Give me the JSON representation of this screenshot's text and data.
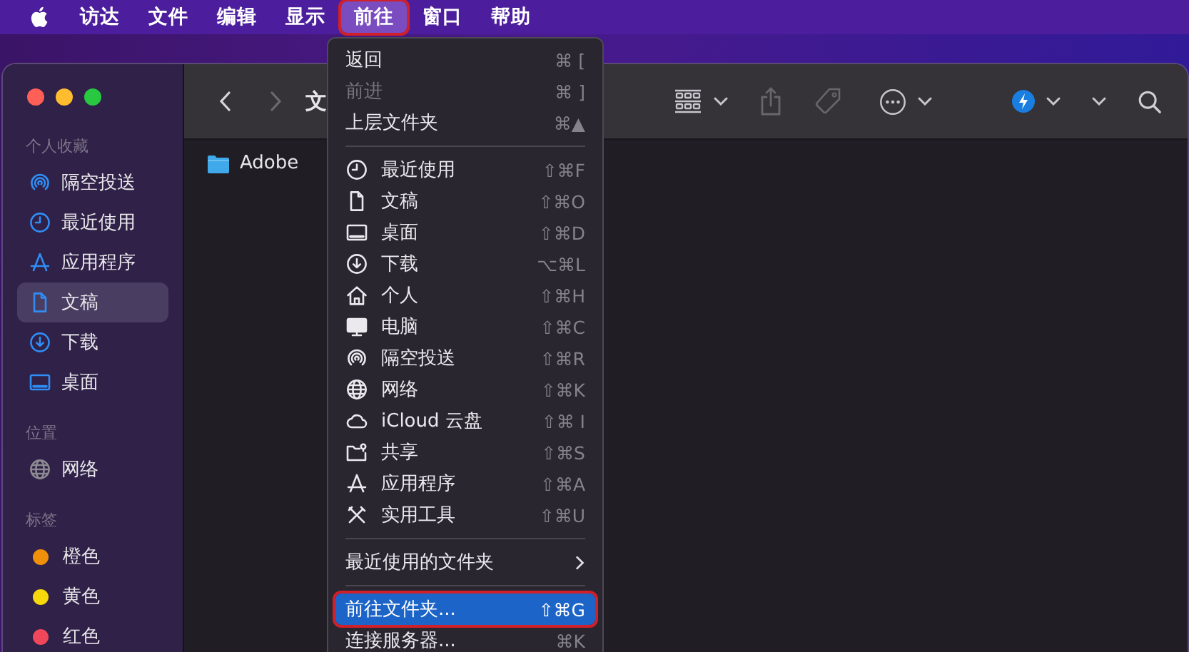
{
  "menubar": {
    "items": [
      {
        "label": "访达",
        "selected": false,
        "annotated": false
      },
      {
        "label": "文件",
        "selected": false,
        "annotated": false
      },
      {
        "label": "编辑",
        "selected": false,
        "annotated": false
      },
      {
        "label": "显示",
        "selected": false,
        "annotated": false
      },
      {
        "label": "前往",
        "selected": true,
        "annotated": true
      },
      {
        "label": "窗口",
        "selected": false,
        "annotated": false
      },
      {
        "label": "帮助",
        "selected": false,
        "annotated": false
      }
    ]
  },
  "window": {
    "title": "文"
  },
  "sidebar": {
    "sections": [
      {
        "heading": "个人收藏",
        "items": [
          {
            "kind": "airdrop",
            "label": "隔空投送",
            "selected": false
          },
          {
            "kind": "clock",
            "label": "最近使用",
            "selected": false
          },
          {
            "kind": "apps",
            "label": "应用程序",
            "selected": false
          },
          {
            "kind": "doc",
            "label": "文稿",
            "selected": true
          },
          {
            "kind": "download",
            "label": "下载",
            "selected": false
          },
          {
            "kind": "desktop",
            "label": "桌面",
            "selected": false
          }
        ]
      },
      {
        "heading": "位置",
        "items": [
          {
            "kind": "globe",
            "label": "网络",
            "selected": false
          }
        ]
      },
      {
        "heading": "标签",
        "items": [
          {
            "kind": "tag",
            "label": "橙色",
            "selected": false,
            "color": "#f0900a"
          },
          {
            "kind": "tag",
            "label": "黄色",
            "selected": false,
            "color": "#f5d90a"
          },
          {
            "kind": "tag",
            "label": "红色",
            "selected": false,
            "color": "#f0485a"
          }
        ]
      }
    ]
  },
  "files": [
    {
      "name": "Adobe"
    }
  ],
  "menu": {
    "items": [
      {
        "kind": "item",
        "label": "返回",
        "shortcut": "⌘ [",
        "disabled": false,
        "selected": false,
        "annotated": false
      },
      {
        "kind": "item",
        "label": "前进",
        "shortcut": "⌘ ]",
        "disabled": true,
        "selected": false,
        "annotated": false
      },
      {
        "kind": "item",
        "label": "上层文件夹",
        "shortcut": "⌘▲",
        "disabled": false,
        "selected": false,
        "annotated": false
      },
      {
        "kind": "separator"
      },
      {
        "kind": "clock",
        "label": "最近使用",
        "shortcut": "⇧⌘F",
        "disabled": false,
        "selected": false,
        "annotated": false
      },
      {
        "kind": "doc",
        "label": "文稿",
        "shortcut": "⇧⌘O",
        "disabled": false,
        "selected": false,
        "annotated": false
      },
      {
        "kind": "desktop",
        "label": "桌面",
        "shortcut": "⇧⌘D",
        "disabled": false,
        "selected": false,
        "annotated": false
      },
      {
        "kind": "download",
        "label": "下载",
        "shortcut": "⌥⌘L",
        "disabled": false,
        "selected": false,
        "annotated": false
      },
      {
        "kind": "home",
        "label": "个人",
        "shortcut": "⇧⌘H",
        "disabled": false,
        "selected": false,
        "annotated": false
      },
      {
        "kind": "computer",
        "label": "电脑",
        "shortcut": "⇧⌘C",
        "disabled": false,
        "selected": false,
        "annotated": false
      },
      {
        "kind": "airdrop",
        "label": "隔空投送",
        "shortcut": "⇧⌘R",
        "disabled": false,
        "selected": false,
        "annotated": false
      },
      {
        "kind": "globe",
        "label": "网络",
        "shortcut": "⇧⌘K",
        "disabled": false,
        "selected": false,
        "annotated": false
      },
      {
        "kind": "cloud",
        "label": "iCloud 云盘",
        "shortcut": "⇧⌘ I",
        "disabled": false,
        "selected": false,
        "annotated": false
      },
      {
        "kind": "shared",
        "label": "共享",
        "shortcut": "⇧⌘S",
        "disabled": false,
        "selected": false,
        "annotated": false
      },
      {
        "kind": "apps",
        "label": "应用程序",
        "shortcut": "⇧⌘A",
        "disabled": false,
        "selected": false,
        "annotated": false
      },
      {
        "kind": "tools",
        "label": "实用工具",
        "shortcut": "⇧⌘U",
        "disabled": false,
        "selected": false,
        "annotated": false
      },
      {
        "kind": "separator"
      },
      {
        "kind": "submenu",
        "label": "最近使用的文件夹",
        "disabled": false,
        "selected": false,
        "annotated": false
      },
      {
        "kind": "separator"
      },
      {
        "kind": "item",
        "label": "前往文件夹...",
        "shortcut": "⇧⌘G",
        "disabled": false,
        "selected": true,
        "annotated": true
      },
      {
        "kind": "item",
        "label": "连接服务器...",
        "shortcut": "⌘K",
        "disabled": false,
        "selected": false,
        "annotated": false
      }
    ]
  }
}
